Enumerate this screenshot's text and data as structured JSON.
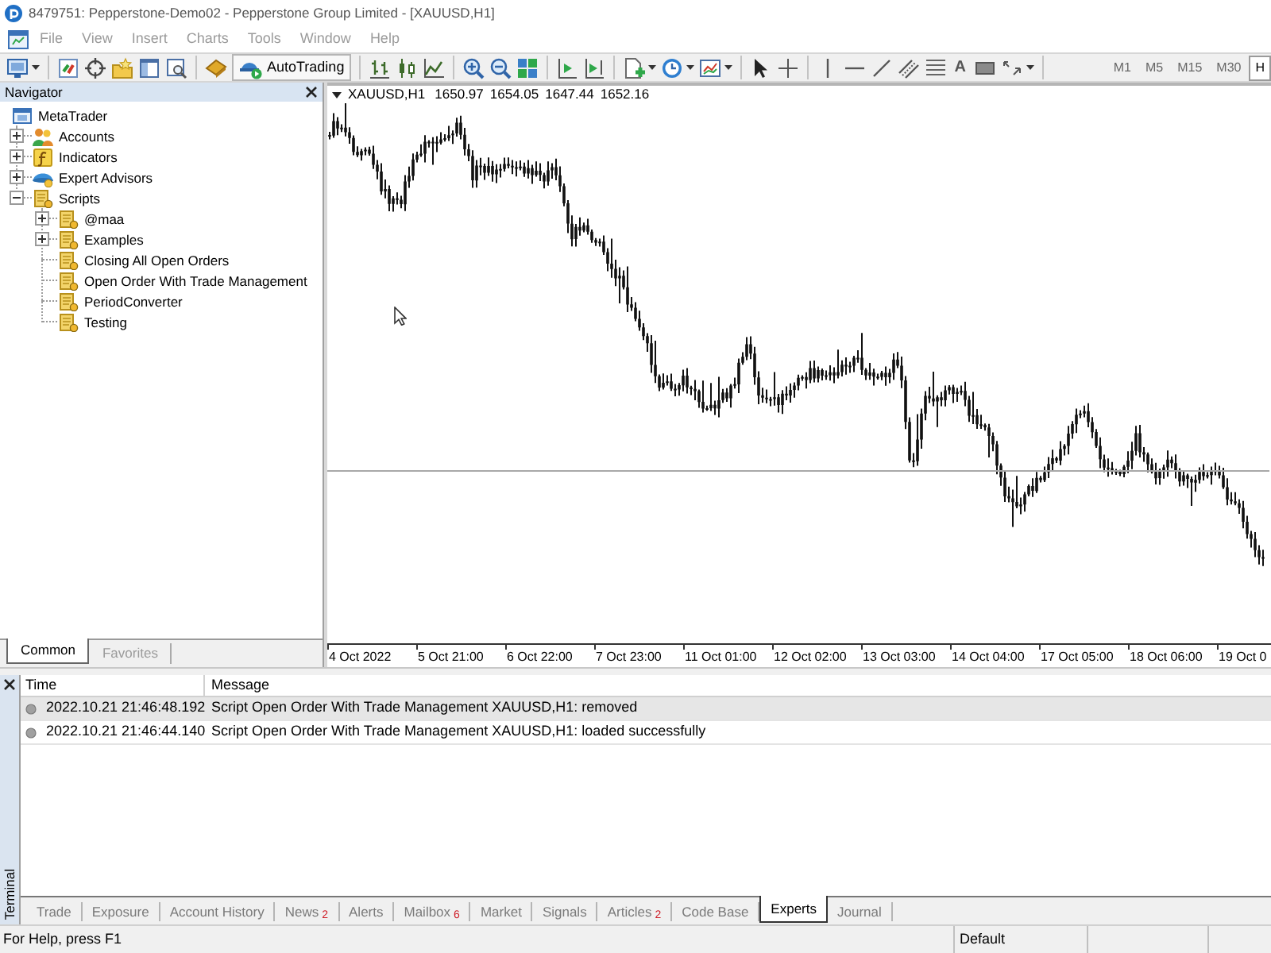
{
  "window": {
    "title": "8479751: Pepperstone-Demo02 - Pepperstone Group Limited - [XAUUSD,H1]"
  },
  "menu": [
    "File",
    "View",
    "Insert",
    "Charts",
    "Tools",
    "Window",
    "Help"
  ],
  "toolbar": {
    "autotrading_label": "AutoTrading",
    "text_tool_label": "A",
    "timeframes": [
      {
        "label": "M1",
        "selected": false
      },
      {
        "label": "M5",
        "selected": false
      },
      {
        "label": "M15",
        "selected": false
      },
      {
        "label": "M30",
        "selected": false
      },
      {
        "label": "H",
        "selected": true
      }
    ]
  },
  "navigator": {
    "title": "Navigator",
    "tree": [
      {
        "label": "MetaTrader",
        "kind": "root",
        "selected": false,
        "children": [
          {
            "label": "Accounts",
            "kind": "accounts",
            "expanded": false,
            "selected": false
          },
          {
            "label": "Indicators",
            "kind": "indicators",
            "expanded": false,
            "selected": false
          },
          {
            "label": "Expert Advisors",
            "kind": "experts",
            "expanded": false,
            "selected": false
          },
          {
            "label": "Scripts",
            "kind": "script",
            "expanded": true,
            "selected": false,
            "children": [
              {
                "label": "@maa",
                "kind": "script",
                "expanded": false,
                "selected": false
              },
              {
                "label": "Examples",
                "kind": "script",
                "expanded": false,
                "selected": false
              },
              {
                "label": "Closing All Open Orders",
                "kind": "script",
                "selected": false
              },
              {
                "label": "Open Order With Trade Management",
                "kind": "script",
                "selected": false
              },
              {
                "label": "PeriodConverter",
                "kind": "script",
                "selected": false
              },
              {
                "label": "Testing",
                "kind": "script",
                "selected": false
              }
            ]
          }
        ]
      }
    ],
    "tabs": [
      {
        "label": "Common",
        "selected": true
      },
      {
        "label": "Favorites",
        "selected": false
      }
    ]
  },
  "chart": {
    "symbol": "XAUUSD,H1",
    "ohlc": [
      "1650.97",
      "1654.05",
      "1647.44",
      "1652.16"
    ],
    "time_labels": [
      "4 Oct 2022",
      "5 Oct 21:00",
      "6 Oct 22:00",
      "7 Oct 23:00",
      "11 Oct 01:00",
      "12 Oct 02:00",
      "13 Oct 03:00",
      "14 Oct 04:00",
      "17 Oct 05:00",
      "18 Oct 06:00",
      "19 Oct 0"
    ]
  },
  "terminal": {
    "title": "Terminal",
    "columns": [
      "Time",
      "Message"
    ],
    "rows": [
      {
        "time": "2022.10.21 21:46:48.192",
        "message": "Script Open Order With Trade Management XAUUSD,H1: removed",
        "selected": true
      },
      {
        "time": "2022.10.21 21:46:44.140",
        "message": "Script Open Order With Trade Management XAUUSD,H1: loaded successfully",
        "selected": false
      }
    ],
    "tabs": [
      {
        "label": "Trade",
        "selected": false
      },
      {
        "label": "Exposure",
        "selected": false
      },
      {
        "label": "Account History",
        "selected": false
      },
      {
        "label": "News",
        "badge": "2",
        "selected": false
      },
      {
        "label": "Alerts",
        "selected": false
      },
      {
        "label": "Mailbox",
        "badge": "6",
        "selected": false
      },
      {
        "label": "Market",
        "selected": false
      },
      {
        "label": "Signals",
        "selected": false
      },
      {
        "label": "Articles",
        "badge": "2",
        "selected": false
      },
      {
        "label": "Code Base",
        "selected": false
      },
      {
        "label": "Experts",
        "selected": true
      },
      {
        "label": "Journal",
        "selected": false
      }
    ]
  },
  "status_bar": {
    "help": "For Help, press F1",
    "profile": "Default"
  }
}
